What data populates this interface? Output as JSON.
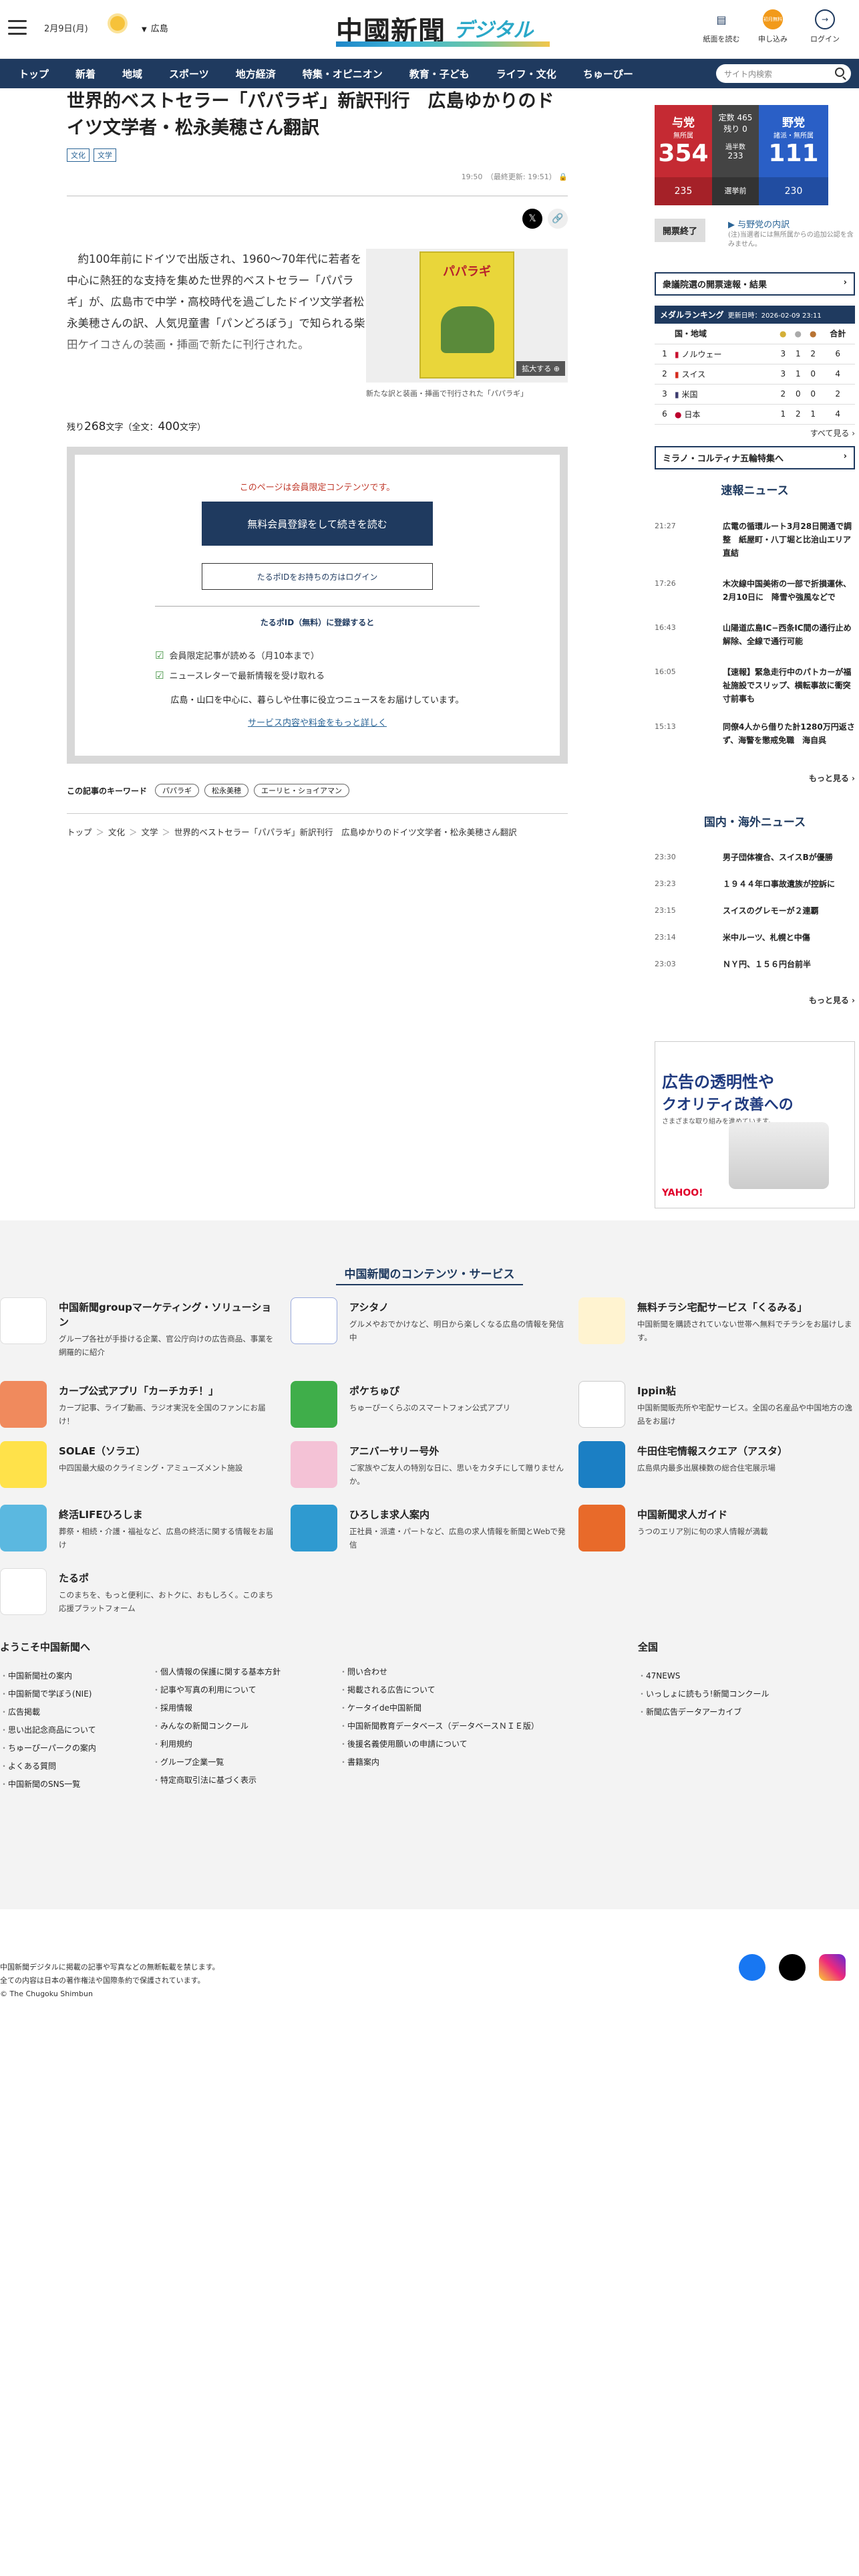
{
  "header": {
    "date": "2月9日(月)",
    "region": "広島",
    "logo_kanji": "中國新聞",
    "logo_digital": "デジタル",
    "icons": [
      {
        "label": "紙面を読む",
        "icon": "newspaper-icon"
      },
      {
        "label": "申し込み",
        "icon": "apply-icon",
        "badge": "初月無料"
      },
      {
        "label": "ログイン",
        "icon": "login-icon"
      }
    ]
  },
  "nav": {
    "items": [
      "トップ",
      "新着",
      "地域",
      "スポーツ",
      "地方経済",
      "特集・オピニオン",
      "教育・子ども",
      "ライフ・文化",
      "ちゅーぴー"
    ],
    "search_placeholder": "サイト内検索"
  },
  "article": {
    "title": "世界的ベストセラー「パパラギ」新訳刊行　広島ゆかりのドイツ文学者・松永美穂さん翻訳",
    "tags": [
      "文化",
      "文学"
    ],
    "time": "19:50　（最終更新: 19:51）",
    "body": "約100年前にドイツで出版され、1960〜70年代に若者を中心に熱狂的な支持を集めた世界的ベストセラー「パパラギ」が、広島市で中学・高校時代を過ごしたドイツ文学者松永美穂さんの訳、人気児童書「パンどろぼう」で知られる柴田ケイコさんの装画・挿画で新たに刊行された。",
    "book_title": "パパラギ",
    "zoom_label": "拡大する",
    "caption": "新たな訳と装画・挿画で刊行された「パパラギ」",
    "count_prefix": "残り",
    "count_remain": "268",
    "count_mid": "文字（全文：",
    "count_total": "400",
    "count_suffix": "文字）"
  },
  "paywall": {
    "notice": "このページは会員限定コンテンツです。",
    "register": "無料会員登録をして続きを読む",
    "login": "たるポIDをお持ちの方はログイン",
    "sub": "たるポID（無料）に登録すると",
    "benefits": [
      "会員限定記事が読める（月10本まで）",
      "ニュースレターで最新情報を受け取れる"
    ],
    "desc": "広島・山口を中心に、暮らしや仕事に役立つニュースをお届けしています。",
    "more": "サービス内容や料金をもっと詳しく"
  },
  "keywords": {
    "label": "この記事のキーワード",
    "items": [
      "パパラギ",
      "松永美穂",
      "エーリヒ・ショイアマン"
    ]
  },
  "breadcrumb": [
    "トップ",
    "文化",
    "文学",
    "世界的ベストセラー「パパラギ」新訳刊行　広島ゆかりのドイツ文学者・松永美穂さん翻訳"
  ],
  "election": {
    "ruling": {
      "name": "与党",
      "sub": "無所属",
      "total": "354",
      "bottom": "235"
    },
    "center": {
      "l1": "定数 465",
      "l2": "残り 0",
      "l3": "過半数",
      "l4": "233",
      "l5": "選挙前"
    },
    "opp": {
      "name": "野党",
      "sub": "諸派・無所属",
      "total": "111",
      "bottom": "230"
    },
    "status": "開票終了",
    "link": "与野党の内訳",
    "note": "(注)当選者には無所属からの追加公認を含みません。"
  },
  "box1": "衆議院選の開票速報・結果",
  "medal": {
    "title": "メダルランキング",
    "updated": "更新日時：2026-02-09 23:11",
    "header": [
      "国・地域",
      "金",
      "銀",
      "銅",
      "合計"
    ],
    "rows": [
      {
        "rank": "1",
        "country": "ノルウェー",
        "g": "3",
        "s": "1",
        "b": "2",
        "t": "6"
      },
      {
        "rank": "2",
        "country": "スイス",
        "g": "3",
        "s": "1",
        "b": "0",
        "t": "4"
      },
      {
        "rank": "3",
        "country": "米国",
        "g": "2",
        "s": "0",
        "b": "0",
        "t": "2"
      },
      {
        "rank": "6",
        "country": "日本",
        "g": "1",
        "s": "2",
        "b": "1",
        "t": "4"
      }
    ],
    "more": "すべて見る"
  },
  "box2": "ミラノ・コルティナ五輪特集へ",
  "fast": {
    "title": "速報ニュース",
    "items": [
      {
        "time": "21:27",
        "text": "広電の循環ルート3月28日開通で調整　紙屋町・八丁堀と比治山エリア直結"
      },
      {
        "time": "17:26",
        "text": "木次線中国美術の一部で折損運休、2月10日に　降雪や強風などで"
      },
      {
        "time": "16:43",
        "text": "山陽道広島IC−西条IC間の通行止め解除、全線で通行可能"
      },
      {
        "time": "16:05",
        "text": "【速報】緊急走行中のパトカーが福祉施設でスリップ、横転事故に衝突寸前事も"
      },
      {
        "time": "15:13",
        "text": "同僚4人から借りた計1280万円返さず、海警を懲戒免職　海自呉"
      }
    ],
    "more": "もっと見る"
  },
  "world": {
    "title": "国内・海外ニュース",
    "items": [
      {
        "time": "23:30",
        "text": "男子団体複合、スイスBが優勝"
      },
      {
        "time": "23:23",
        "text": "１９４４年ロ事故遺族が控訴に"
      },
      {
        "time": "23:15",
        "text": "スイスのグレモーが２連覇"
      },
      {
        "time": "23:14",
        "text": "米中ルーツ、札幌と中傷"
      },
      {
        "time": "23:03",
        "text": "ＮＹ円、１５６円台前半"
      }
    ],
    "more": "もっと見る"
  },
  "ad": {
    "l1": "広告の透明性や",
    "l2": "クオリティ改善への",
    "l3": "さまざまな取り組みを進めています。",
    "brand": "YAHOO!"
  },
  "footer": {
    "title": "中国新聞のコンテンツ・サービス",
    "services": [
      {
        "name": "中国新聞groupマーケティング・ソリューション",
        "desc": "グループ各社が手掛ける企業、官公庁向けの広告商品、事業を網羅的に紹介"
      },
      {
        "name": "アシタノ",
        "desc": "グルメやおでかけなど、明日から楽しくなる広島の情報を発信中"
      },
      {
        "name": "無料チラシ宅配サービス「くるみる」",
        "desc": "中国新聞を購読されていない世帯へ無料でチラシをお届けします。"
      },
      {
        "name": "カープ公式アプリ「カーチカチ！」",
        "desc": "カープ記事、ライブ動画、ラジオ実況を全国のファンにお届け！"
      },
      {
        "name": "ポケちゅぴ",
        "desc": "ちゅーぴーくらぶのスマートフォン公式アプリ"
      },
      {
        "name": "Ippin粘",
        "desc": "中国新聞販売所や宅配サービス。全国の名産品や中国地方の逸品をお届け"
      },
      {
        "name": "SOLAE（ソラエ）",
        "desc": "中四国最大級のクライミング・アミューズメント施設"
      },
      {
        "name": "アニバーサリー号外",
        "desc": "ご家族やご友人の特別な日に、思いをカタチにして贈りませんか。"
      },
      {
        "name": "牛田住宅情報スクエア（アスタ）",
        "desc": "広島県内最多出展棟数の総合住宅展示場"
      },
      {
        "name": "終活LIFEひろしま",
        "desc": "葬祭・相続・介護・福祉など、広島の終活に関する情報をお届け"
      },
      {
        "name": "ひろしま求人案内",
        "desc": "正社員・派遣・パートなど、広島の求人情報を新聞とWebで発信"
      },
      {
        "name": "中国新聞求人ガイド",
        "desc": "うつのエリア別に旬の求人情報が満載"
      },
      {
        "name": "たるポ",
        "desc": "このまちを、もっと便利に、おトクに、おもしろく。このまち応援プラットフォーム"
      }
    ],
    "links": {
      "heading": "ようこそ中国新聞へ",
      "col1": [
        "中国新聞社の案内",
        "中国新聞で学ぼう(NIE)",
        "広告掲載",
        "思い出記念商品について",
        "ちゅーぴーパークの案内",
        "よくある質問",
        "中国新聞のSNS一覧"
      ],
      "col2": [
        "個人情報の保護に関する基本方針",
        "記事や写真の利用について",
        "採用情報",
        "みんなの新聞コンクール",
        "利用規約",
        "グループ企業一覧",
        "特定商取引法に基づく表示"
      ],
      "col3": [
        "問い合わせ",
        "掲載される広告について",
        "ケータイde中国新聞",
        "中国新聞教育データベース（データベースＮＩＥ版）",
        "後援名義使用願いの申請について",
        "書籍案内"
      ],
      "heading2": "全国",
      "col4": [
        "47NEWS",
        "いっしょに読もう!新聞コンクール",
        "新聞広告データアーカイブ"
      ]
    },
    "copy": [
      "中国新聞デジタルに掲載の記事や写真などの無断転載を禁じます。",
      "全ての内容は日本の著作権法や国際条約で保護されています。",
      "© The Chugoku Shimbun"
    ]
  },
  "colors": {
    "navy": "#1f3a5f",
    "ruling": "#c52a33",
    "opp": "#2a5fc6"
  }
}
